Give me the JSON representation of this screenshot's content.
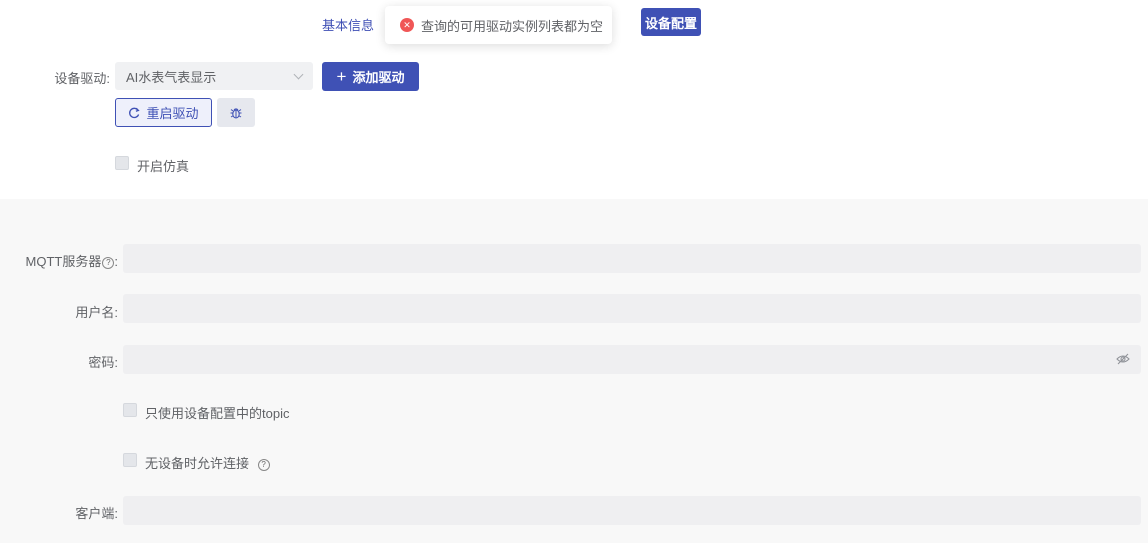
{
  "tabs": {
    "basic_info": "基本信息",
    "device_config": "设备配置"
  },
  "toast": {
    "message": "查询的可用驱动实例列表都为空"
  },
  "driver": {
    "label": "设备驱动:",
    "selected": "AI水表气表显示",
    "add_button": "添加驱动",
    "restart_button": "重启驱动"
  },
  "simulation": {
    "label": "开启仿真"
  },
  "form": {
    "mqtt_server_label": "MQTT服务器",
    "colon": ":",
    "username_label": "用户名:",
    "password_label": "密码:",
    "only_topic_label": "只使用设备配置中的topic",
    "allow_no_device_label": "无设备时允许连接",
    "client_label": "客户端:",
    "help_glyph": "?"
  },
  "colors": {
    "primary": "#3f51b5",
    "error": "#f05656"
  }
}
